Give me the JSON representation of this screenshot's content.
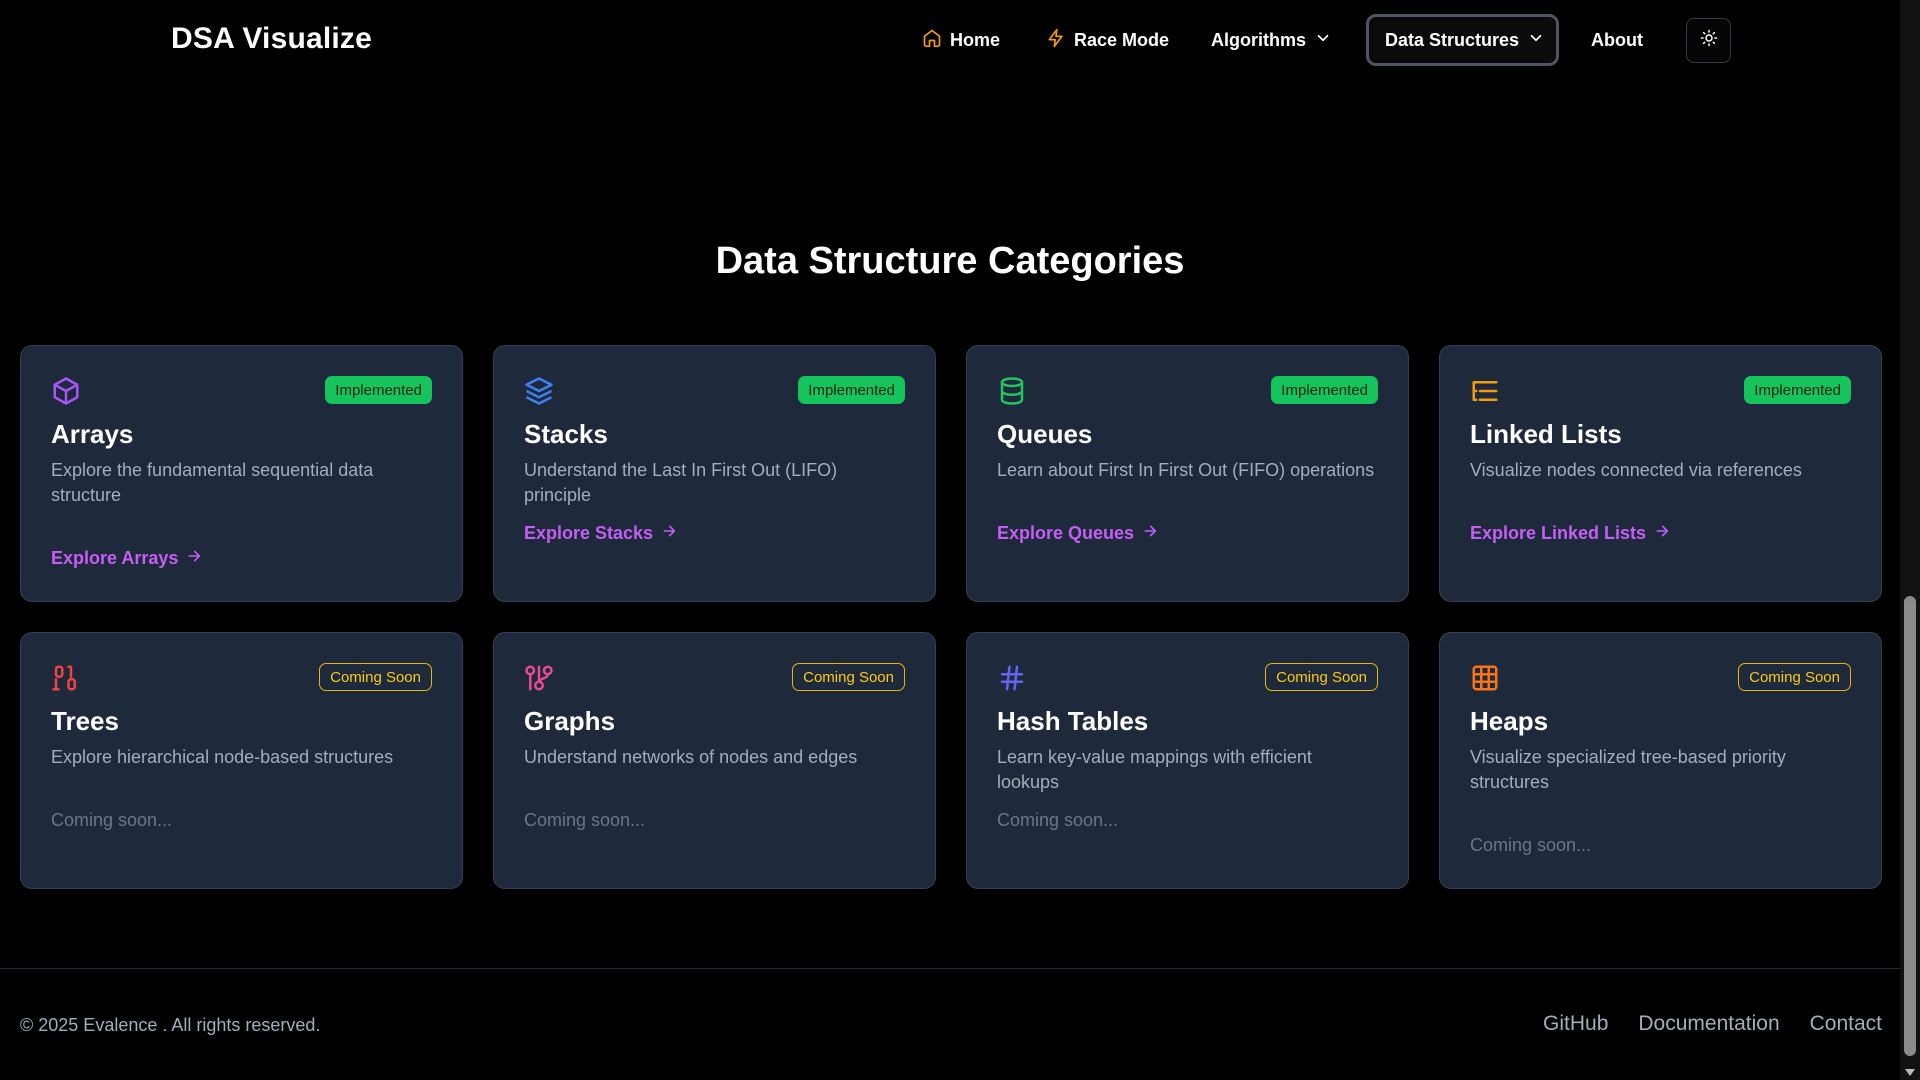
{
  "brand": "DSA Visualize",
  "nav": {
    "home": "Home",
    "race": "Race Mode",
    "algorithms": "Algorithms",
    "data_structures": "Data Structures",
    "about": "About"
  },
  "section_title": "Data Structure Categories",
  "cards": [
    {
      "title": "Arrays",
      "badge": "Implemented",
      "desc": "Explore the fundamental sequential data structure",
      "action": "Explore Arrays",
      "icon": "cube-icon",
      "icon_color": "#a855f7"
    },
    {
      "title": "Stacks",
      "badge": "Implemented",
      "desc": "Understand the Last In First Out (LIFO) principle",
      "action": "Explore Stacks",
      "icon": "layers-icon",
      "icon_color": "#3b82f6"
    },
    {
      "title": "Queues",
      "badge": "Implemented",
      "desc": "Learn about First In First Out (FIFO) operations",
      "action": "Explore Queues",
      "icon": "database-icon",
      "icon_color": "#22c55e"
    },
    {
      "title": "Linked Lists",
      "badge": "Implemented",
      "desc": "Visualize nodes connected via references",
      "action": "Explore Linked Lists",
      "icon": "list-tree-icon",
      "icon_color": "#f59e0b"
    },
    {
      "title": "Trees",
      "badge": "Coming Soon",
      "desc": "Explore hierarchical node-based structures",
      "action": "Coming soon...",
      "icon": "binary-icon",
      "icon_color": "#ef4444"
    },
    {
      "title": "Graphs",
      "badge": "Coming Soon",
      "desc": "Understand networks of nodes and edges",
      "action": "Coming soon...",
      "icon": "git-network-icon",
      "icon_color": "#ec4899"
    },
    {
      "title": "Hash Tables",
      "badge": "Coming Soon",
      "desc": "Learn key-value mappings with efficient lookups",
      "action": "Coming soon...",
      "icon": "hash-icon",
      "icon_color": "#6366f1"
    },
    {
      "title": "Heaps",
      "badge": "Coming Soon",
      "desc": "Visualize specialized tree-based priority structures",
      "action": "Coming soon...",
      "icon": "grid-icon",
      "icon_color": "#f97316"
    }
  ],
  "footer": {
    "copyright": "© 2025 Evalence . All rights reserved.",
    "links": [
      "GitHub",
      "Documentation",
      "Contact"
    ]
  },
  "colors": {
    "background": "#000000",
    "card": "#1e293b",
    "implemented_badge": "#16c45c",
    "coming_soon_badge": "#eab308",
    "link": "#c45ef5"
  }
}
